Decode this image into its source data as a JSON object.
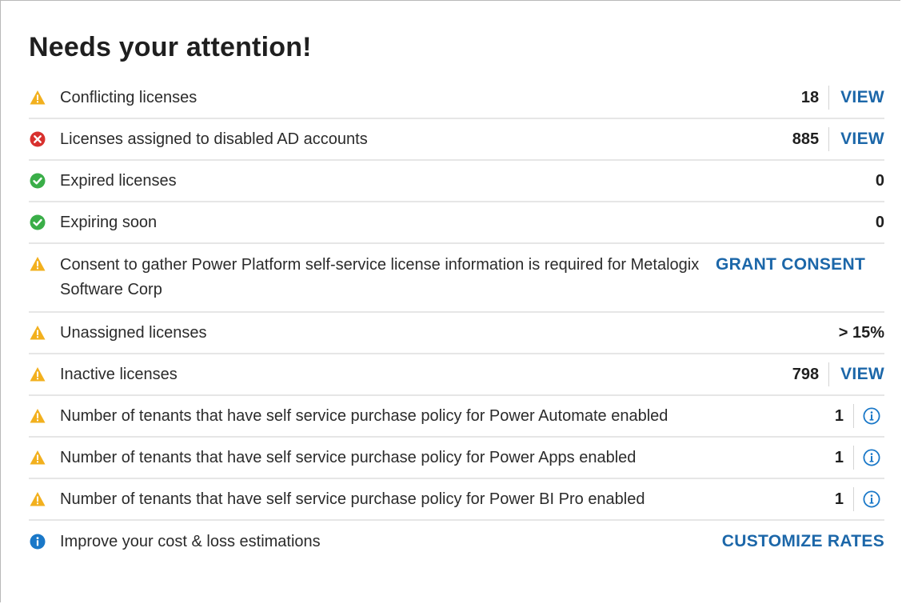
{
  "title": "Needs your attention!",
  "colors": {
    "warning": "#f2b01e",
    "error": "#d8312e",
    "ok": "#3aae48",
    "info": "#1a78c8",
    "link": "#1c67a9"
  },
  "rows": [
    {
      "icon": "warning-icon",
      "label": "Conflicting licenses",
      "value": "18",
      "action": "VIEW"
    },
    {
      "icon": "error-icon",
      "label": "Licenses assigned to disabled AD accounts",
      "value": "885",
      "action": "VIEW"
    },
    {
      "icon": "check-icon",
      "label": "Expired licenses",
      "value": "0"
    },
    {
      "icon": "check-icon",
      "label": "Expiring soon",
      "value": "0"
    },
    {
      "icon": "warning-icon",
      "label": "Consent to gather Power Platform self-service license information is required for Metalogix Software Corp",
      "action": "GRANT CONSENT"
    },
    {
      "icon": "warning-icon",
      "label": "Unassigned licenses",
      "value": "> 15%"
    },
    {
      "icon": "warning-icon",
      "label": "Inactive licenses",
      "value": "798",
      "action": "VIEW"
    },
    {
      "icon": "warning-icon",
      "label": "Number of tenants that have self service purchase policy for Power Automate enabled",
      "value": "1",
      "action_icon": "info-circle-icon"
    },
    {
      "icon": "warning-icon",
      "label": "Number of tenants that have self service purchase policy for Power Apps enabled",
      "value": "1",
      "action_icon": "info-circle-icon"
    },
    {
      "icon": "warning-icon",
      "label": "Number of tenants that have self service purchase policy for Power BI Pro enabled",
      "value": "1",
      "action_icon": "info-circle-icon"
    },
    {
      "icon": "info-icon",
      "label": "Improve your cost & loss estimations",
      "action": "CUSTOMIZE RATES"
    }
  ]
}
